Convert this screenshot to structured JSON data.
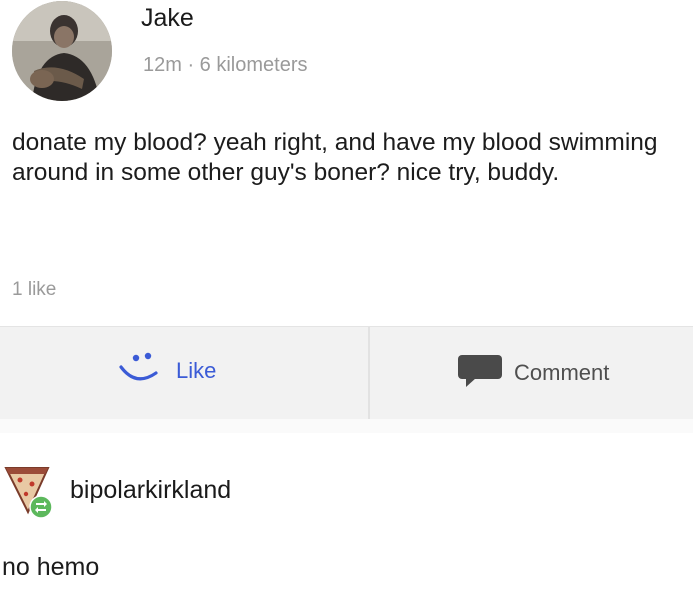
{
  "post": {
    "author": "Jake",
    "meta": "12m · 6 kilometers",
    "text": "donate my blood? yeah right, and have my blood swimming around in some other guy's boner? nice try, buddy.",
    "likes_count": "1 like",
    "actions": {
      "like_label": "Like",
      "comment_label": "Comment"
    }
  },
  "reblog": {
    "username": "bipolarkirkland",
    "text": "no hemo"
  },
  "colors": {
    "like_accent": "#3b5bd6",
    "comment_icon": "#4a4a4a",
    "reblog_badge": "#5cb85c"
  },
  "icons": {
    "like": "smiley-icon",
    "comment": "speech-bubble-icon",
    "reblog": "reblog-icon"
  }
}
